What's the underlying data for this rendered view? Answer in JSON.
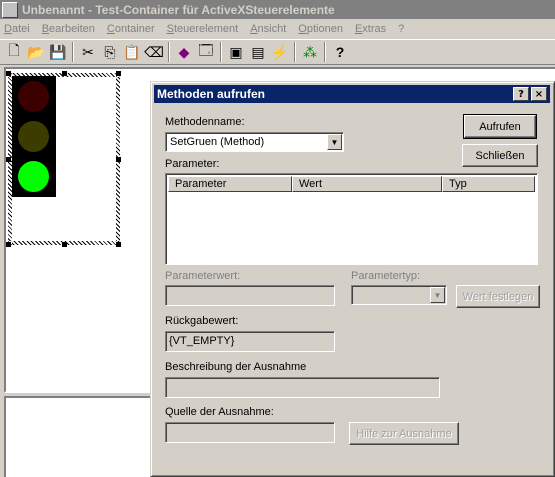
{
  "window": {
    "title": "Unbenannt - Test-Container für ActiveXSteuerelemente"
  },
  "menubar": [
    "Datei",
    "Bearbeiten",
    "Container",
    "Steuerelement",
    "Ansicht",
    "Optionen",
    "Extras",
    "?"
  ],
  "toolbar": [
    {
      "icon": "new-icon",
      "glyph": "🗋"
    },
    {
      "icon": "open-icon",
      "glyph": "📂"
    },
    {
      "icon": "save-icon",
      "glyph": "💾"
    },
    {
      "icon": "cut-icon",
      "glyph": "✂"
    },
    {
      "icon": "copy-icon",
      "glyph": "⎘"
    },
    {
      "icon": "paste-icon",
      "glyph": "📋"
    },
    {
      "icon": "delete-icon",
      "glyph": "⌫"
    },
    {
      "icon": "insert-control-icon",
      "glyph": "◆"
    },
    {
      "icon": "properties-icon",
      "glyph": "🗔"
    },
    {
      "icon": "invoke-methods-icon",
      "glyph": "▣"
    },
    {
      "icon": "ui-active-icon",
      "glyph": "▤"
    },
    {
      "icon": "events-icon",
      "glyph": "⚡"
    },
    {
      "icon": "tree-icon",
      "glyph": "⁂"
    },
    {
      "icon": "help-icon",
      "glyph": "?"
    }
  ],
  "traffic_light": {
    "lamps": [
      "#3c0000",
      "#3c3c00",
      "#00ff00"
    ]
  },
  "dialog": {
    "title": "Methoden aufrufen",
    "help_button": "?",
    "close_button": "×",
    "method_name_label": "Methodenname:",
    "method_name_value": "SetGruen (Method)",
    "invoke_button": "Aufrufen",
    "close_button_label": "Schließen",
    "parameters_label": "Parameter:",
    "columns": [
      "Parameter",
      "Wert",
      "Typ"
    ],
    "param_value_label": "Parameterwert:",
    "param_type_label": "Parametertyp:",
    "set_value_button": "Wert festlegen",
    "return_value_label": "Rückgabewert:",
    "return_value": "{VT_EMPTY}",
    "exception_desc_label": "Beschreibung der Ausnahme",
    "exception_source_label": "Quelle der Ausnahme:",
    "exception_help_button": "Hilfe zur Ausnahme"
  }
}
